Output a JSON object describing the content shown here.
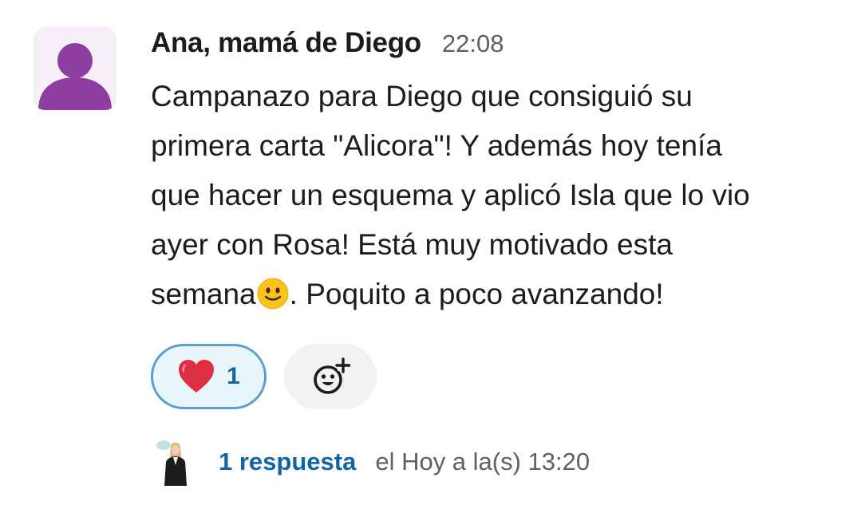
{
  "message": {
    "author": "Ana, mamá de Diego",
    "time": "22:08",
    "body_lines": [
      "Campanazo para Diego que consiguió su",
      "primera carta \"Alicora\"!  Y además hoy tenía",
      "que hacer un esquema y aplicó Isla que lo vio",
      "ayer con Rosa! Está muy motivado esta"
    ],
    "last_line_before_emoji": "semana",
    "inline_emoji": "slightly-smiling-face-icon",
    "last_line_after_emoji": ". Poquito a poco avanzando!"
  },
  "reactions": [
    {
      "emoji": "red-heart-icon",
      "count": "1"
    }
  ],
  "add_reaction_icon": "add-emoji-icon",
  "thread": {
    "reply_count_label": "1 respuesta",
    "last_reply_label": "el Hoy a la(s) 13:20"
  },
  "colors": {
    "avatar_purple": "#8e3ea1",
    "avatar_bg": "#f6eff8",
    "link_blue": "#1264a3",
    "reaction_border": "#5a9fd0",
    "reaction_bg": "#e8f5fa",
    "muted_gray": "#616061"
  }
}
